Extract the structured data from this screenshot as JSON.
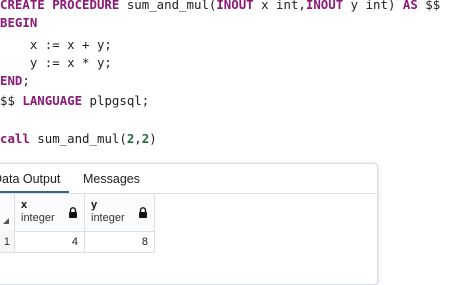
{
  "editor": {
    "line1": {
      "kw1": "CREATE PROCEDURE",
      "name": " sum_and_mul(",
      "kw2": "INOUT",
      "p1": " x int,",
      "kw3": "INOUT",
      "p2": " y int) ",
      "kw4": "AS",
      "tail": " $$"
    },
    "line2": {
      "kw": "BEGIN"
    },
    "line3": {
      "text": "    x := x + y;"
    },
    "line4": {
      "text": "    y := x * y;"
    },
    "line5": {
      "kw": "END",
      "tail": ";"
    },
    "line6": {
      "pre": "$$ ",
      "kw": "LANGUAGE",
      "tail": " plpgsql;"
    },
    "line8": {
      "kw": "call",
      "name": " sum_and_mul(",
      "a": "2",
      "comma": ",",
      "b": "2",
      "close": ")"
    }
  },
  "results": {
    "tabs": {
      "data_output": "Data Output",
      "messages": "Messages"
    },
    "columns": [
      {
        "name": "x",
        "type": "integer"
      },
      {
        "name": "y",
        "type": "integer"
      }
    ],
    "rows": [
      {
        "num": "1",
        "x": "4",
        "y": "8"
      }
    ]
  }
}
